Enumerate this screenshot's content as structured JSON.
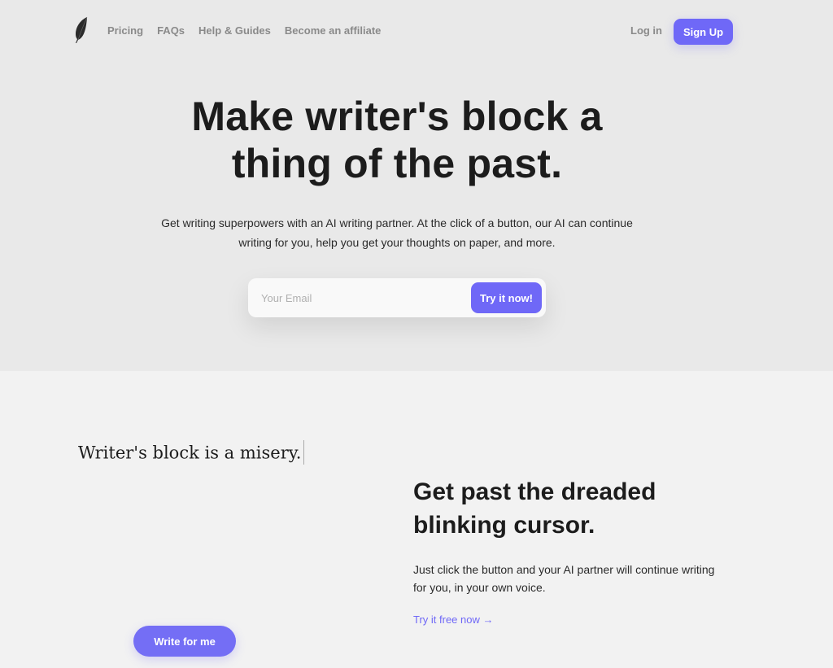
{
  "nav": {
    "logo_icon": "feather-icon",
    "links": [
      {
        "label": "Pricing"
      },
      {
        "label": "FAQs"
      },
      {
        "label": "Help & Guides"
      },
      {
        "label": "Become an affiliate"
      }
    ],
    "login_label": "Log in",
    "signup_label": "Sign Up"
  },
  "hero": {
    "title_line1": "Make writer's block a",
    "title_line2": "thing of the past.",
    "subtitle_line1": "Get writing superpowers with an AI writing partner. At the click of a button, our AI can continue",
    "subtitle_line2": "writing for you, help you get your thoughts on paper, and more.",
    "email_placeholder": "Your Email",
    "email_value": "",
    "cta_label": "Try it now!"
  },
  "demo": {
    "text": "Writer's block is a misery.",
    "button_label": "Write for me"
  },
  "feature": {
    "title_line1": "Get past the dreaded",
    "title_line2": "blinking cursor.",
    "description_line1": "Just click the button and your AI partner will continue writing",
    "description_line2": "for you, in your own voice.",
    "link_label": "Try it free now →"
  },
  "colors": {
    "accent": "#6f68f7",
    "hero_bg": "#e9e9e9",
    "page_bg": "#f2f2f2",
    "text": "#1c1c1c",
    "nav_text": "#8a8a8a"
  }
}
